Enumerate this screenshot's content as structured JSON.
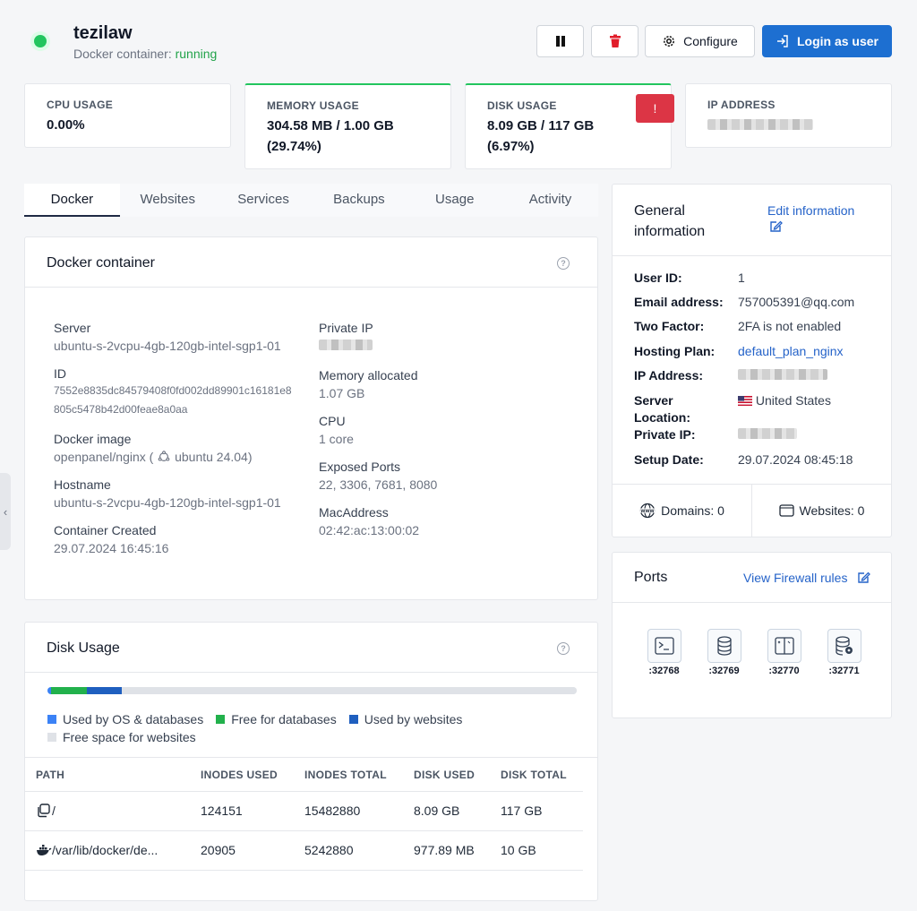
{
  "header": {
    "username": "tezilaw",
    "container_prefix": "Docker container:",
    "container_status": "running",
    "configure_label": "Configure",
    "login_label": "Login as user"
  },
  "stats": {
    "cpu": {
      "label": "CPU USAGE",
      "value": "0.00%"
    },
    "memory": {
      "label": "MEMORY USAGE",
      "value_line1": "304.58 MB / 1.00 GB",
      "value_line2": "(29.74%)"
    },
    "disk": {
      "label": "DISK USAGE",
      "value_line1": "8.09 GB / 117 GB",
      "value_line2": "(6.97%)",
      "alert": "!"
    },
    "ip": {
      "label": "IP ADDRESS"
    }
  },
  "tabs": [
    "Docker",
    "Websites",
    "Services",
    "Backups",
    "Usage",
    "Activity"
  ],
  "docker": {
    "title": "Docker container",
    "help": "?",
    "server_label": "Server",
    "server_value": "ubuntu-s-2vcpu-4gb-120gb-intel-sgp1-01",
    "id_label": "ID",
    "id_line1": "7552e8835dc84579408f0fd002dd89901c16181e8",
    "id_line2": "805c5478b42d00feae8a0aa",
    "image_label": "Docker image",
    "image_value": "openpanel/nginx (",
    "image_os": "ubuntu 24.04)",
    "hostname_label": "Hostname",
    "hostname_value": "ubuntu-s-2vcpu-4gb-120gb-intel-sgp1-01",
    "created_label": "Container Created",
    "created_value": "29.07.2024 16:45:16",
    "private_ip_label": "Private IP",
    "memory_label": "Memory allocated",
    "memory_value": "1.07 GB",
    "cpu_label": "CPU",
    "cpu_value": "1 core",
    "ports_label": "Exposed Ports",
    "ports_value": "22, 3306, 7681, 8080",
    "mac_label": "MacAddress",
    "mac_value": "02:42:ac:13:00:02"
  },
  "disk_usage": {
    "title": "Disk Usage",
    "help": "?",
    "segments": [
      {
        "name": "Used by OS & databases",
        "fraction": 0.006,
        "color": "#3b82f6"
      },
      {
        "name": "Free for databases",
        "fraction": 0.068,
        "color": "#22b14c"
      },
      {
        "name": "Used by websites",
        "fraction": 0.066,
        "color": "#1f5fbf"
      },
      {
        "name": "Free space for websites",
        "fraction": 0.86,
        "color": "#dfe2e7"
      }
    ],
    "legend": {
      "os": "Used by OS & databases",
      "free_db": "Free for databases",
      "websites": "Used by websites",
      "free_web": "Free space for websites"
    },
    "columns": [
      "PATH",
      "INODES USED",
      "INODES TOTAL",
      "DISK USED",
      "DISK TOTAL"
    ],
    "rows": [
      {
        "path": "/",
        "inodes_used": "124151",
        "inodes_total": "15482880",
        "disk_used": "8.09 GB",
        "disk_total": "117 GB"
      },
      {
        "path": "/var/lib/docker/de...",
        "inodes_used": "20905",
        "inodes_total": "5242880",
        "disk_used": "977.89 MB",
        "disk_total": "10 GB"
      }
    ]
  },
  "general": {
    "title_line1": "General",
    "title_line2": "information",
    "edit_label": "Edit information",
    "user_id_key": "User ID:",
    "user_id": "1",
    "email_key": "Email address:",
    "email": "757005391@qq.com",
    "twofa_key": "Two Factor:",
    "twofa": "2FA is not enabled",
    "plan_key": "Hosting Plan:",
    "plan": "default_plan_nginx",
    "ip_key": "IP Address:",
    "location_key_line1": "Server",
    "location_key_line2": "Location:",
    "location": "United States",
    "private_ip_key": "Private IP:",
    "setup_key": "Setup Date:",
    "setup": "29.07.2024 08:45:18",
    "domains": "Domains: 0",
    "websites": "Websites: 0"
  },
  "ports": {
    "title": "Ports",
    "firewall_label": "View Firewall rules",
    "items": [
      {
        "port": ":32768",
        "icon": "terminal-icon"
      },
      {
        "port": ":32769",
        "icon": "database-icon"
      },
      {
        "port": ":32770",
        "icon": "file-manager-icon"
      },
      {
        "port": ":32771",
        "icon": "database-settings-icon"
      }
    ]
  },
  "colors": {
    "accent": "#1d6fd1",
    "running": "#22a34a",
    "danger": "#dc3545"
  }
}
